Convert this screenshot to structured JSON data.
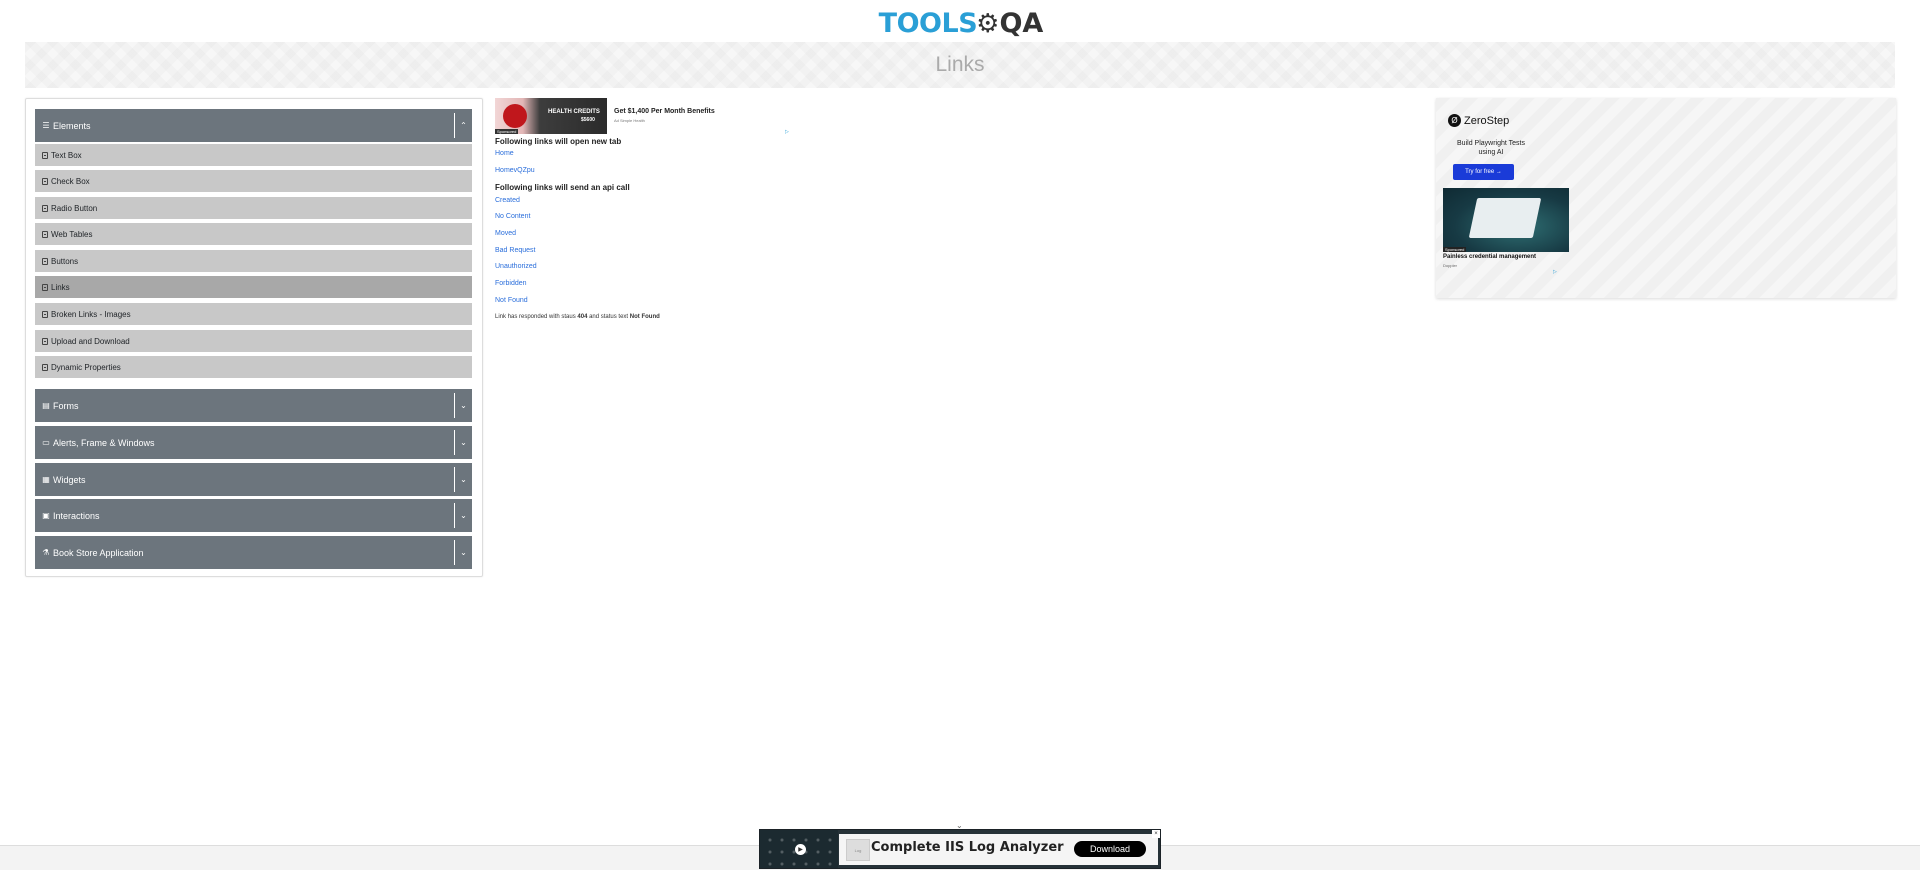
{
  "header": {
    "logo_text": "TOOLS",
    "logo_qa": "QA"
  },
  "page_title": "Links",
  "sidebar": {
    "groups": [
      {
        "label": "Elements",
        "icon": "list-icon",
        "expanded": true,
        "items": [
          {
            "label": "Text Box"
          },
          {
            "label": "Check Box"
          },
          {
            "label": "Radio Button"
          },
          {
            "label": "Web Tables"
          },
          {
            "label": "Buttons"
          },
          {
            "label": "Links",
            "active": true
          },
          {
            "label": "Broken Links - Images"
          },
          {
            "label": "Upload and Download"
          },
          {
            "label": "Dynamic Properties"
          }
        ]
      },
      {
        "label": "Forms",
        "icon": "form-icon",
        "expanded": false
      },
      {
        "label": "Alerts, Frame & Windows",
        "icon": "window-icon",
        "expanded": false
      },
      {
        "label": "Widgets",
        "icon": "grid-icon",
        "expanded": false
      },
      {
        "label": "Interactions",
        "icon": "interaction-icon",
        "expanded": false
      },
      {
        "label": "Book Store Application",
        "icon": "book-icon",
        "expanded": false
      }
    ]
  },
  "ad_top": {
    "image_label": "HEALTH CREDITS",
    "image_amount": "$5600",
    "sponsored": "Sponsored",
    "headline": "Get $1,400 Per Month Benefits",
    "source": "Ad Simple Health",
    "choices": "▷"
  },
  "main": {
    "new_tab_heading": "Following links will open new tab",
    "new_tab_links": [
      "Home",
      "HomevQZpu"
    ],
    "api_heading": "Following links will send an api call",
    "api_links": [
      "Created",
      "No Content",
      "Moved",
      "Bad Request",
      "Unauthorized",
      "Forbidden",
      "Not Found"
    ],
    "result_prefix": "Link has responded with staus",
    "status_code": "404",
    "result_mid": "and status text",
    "status_text": "Not Found"
  },
  "right_ad": {
    "brand": "ZeroStep",
    "tagline": "Build Playwright Tests using AI",
    "button": "Try for free →",
    "sponsored": "Sponsored",
    "caption": "Painless credential management",
    "source": "Doppler",
    "choices": "▷"
  },
  "bottom_ad": {
    "text": "Complete IIS Log Analyzer",
    "button": "Download",
    "thumb_label": "Log"
  },
  "colors": {
    "sidebar_header": "#6c757d",
    "sidebar_item": "#c8c8c8",
    "sidebar_item_active": "#a8a8a8",
    "link": "#2a6edb",
    "brand": "#2a9fd6"
  }
}
